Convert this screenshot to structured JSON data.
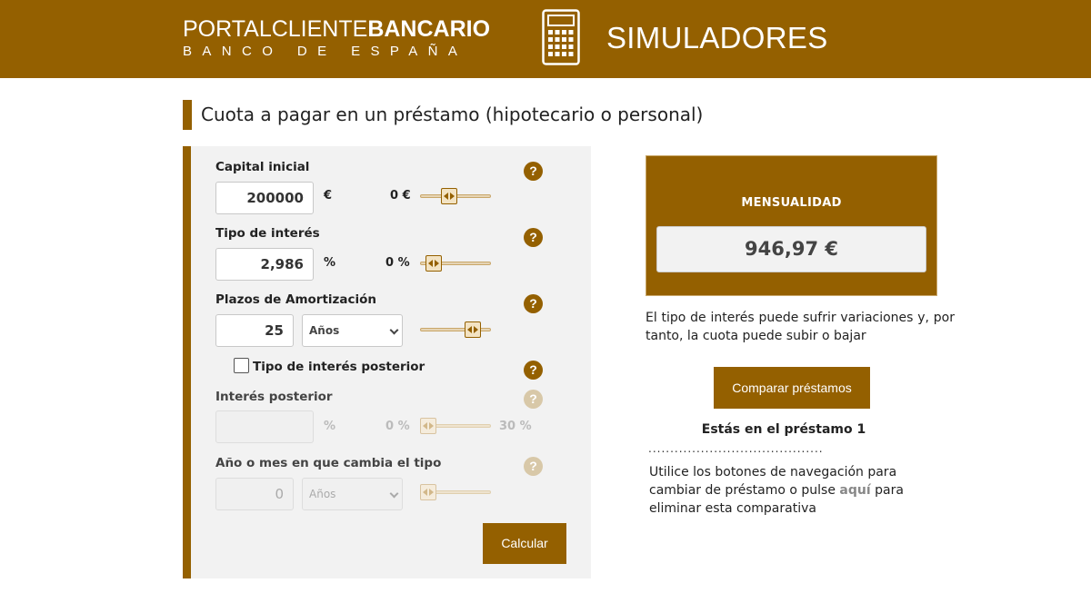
{
  "header": {
    "brand_part1": "PORTAL",
    "brand_part2": "CLIENTE",
    "brand_part3": "BANCARIO",
    "brand_subtitle": "BANCO DE ESPAÑA",
    "section_title": "SIMULADORES",
    "icon": "calculator-icon"
  },
  "page": {
    "title": "Cuota a pagar en un préstamo (hipotecario o personal)"
  },
  "form": {
    "capital": {
      "label": "Capital inicial",
      "value": "200000",
      "unit": "€",
      "min_label": "0 €",
      "slider_level": 0.38
    },
    "interest": {
      "label": "Tipo de interés",
      "value": "2,986",
      "unit": "%",
      "min_label": "0 %",
      "slider_level": 0.1
    },
    "term": {
      "label": "Plazos de Amortización",
      "value": "25",
      "unit_option": "Años",
      "slider_level": 0.82
    },
    "later_rate_checkbox": {
      "label": "Tipo de interés posterior",
      "checked": false
    },
    "later_rate": {
      "label": "Interés posterior",
      "value": "",
      "unit": "%",
      "min_label": "0 %",
      "max_label": "30 %",
      "slider_level": 0.0
    },
    "change_year": {
      "label": "Año o mes en que cambia el tipo",
      "value": "0",
      "unit_option": "Años",
      "slider_level": 0.0
    },
    "help_symbol": "?",
    "calc_button": "Calcular"
  },
  "result": {
    "title": "MENSUALIDAD",
    "value": "946,97 €",
    "note": "El tipo de interés puede sufrir variaciones y, por tanto, la cuota puede subir o bajar",
    "compare_button": "Comparar préstamos",
    "loan_status": "Estás en el préstamo 1",
    "separator": "........................................",
    "help_before": "Utilice los botones de navegación para cambiar de préstamo o pulse ",
    "help_link": "aquí",
    "help_after": " para eliminar esta comparativa"
  },
  "colors": {
    "brand": "#946000",
    "panel": "#f2f2f2"
  }
}
